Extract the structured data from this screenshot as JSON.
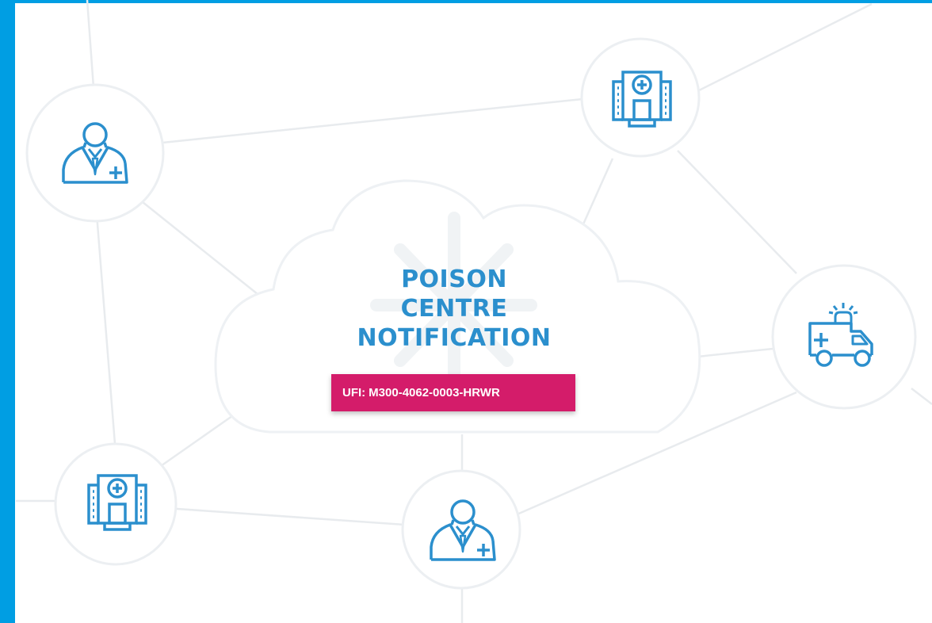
{
  "colors": {
    "frame": "#009ee3",
    "brand_blue": "#2b8fcd",
    "ufi_magenta": "#d41c6a",
    "line_gray": "#e8ebee",
    "node_border": "#eceff2"
  },
  "title": {
    "line1": "POISON",
    "line2": "CENTRE",
    "line3": "NOTIFICATION"
  },
  "ufi": {
    "prefix": "UFI:",
    "code": "M300-4062-0003-HRWR"
  },
  "nodes": [
    {
      "name": "doctor-node-top-left",
      "icon": "doctor-icon"
    },
    {
      "name": "hospital-node-top",
      "icon": "hospital-icon"
    },
    {
      "name": "ambulance-node-right",
      "icon": "ambulance-icon"
    },
    {
      "name": "hospital-node-bottom-left",
      "icon": "hospital-icon"
    },
    {
      "name": "doctor-node-bottom",
      "icon": "doctor-icon"
    }
  ]
}
